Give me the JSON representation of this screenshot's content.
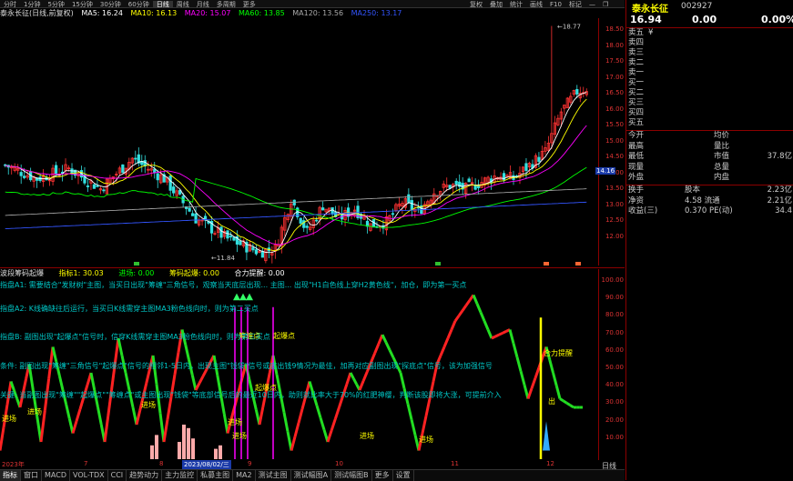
{
  "toolbar": {
    "items": [
      "分时",
      "1分钟",
      "5分钟",
      "15分钟",
      "30分钟",
      "60分钟",
      "日线",
      "周线",
      "月线",
      "多周期",
      "更多"
    ],
    "right_items": [
      "复权",
      "叠加",
      "统计",
      "画线",
      "F10",
      "标记"
    ],
    "right_icons": [
      "minus-icon",
      "restore-icon",
      "close-icon"
    ]
  },
  "main_header": {
    "title": "泰永长征(日线,前复权)",
    "ma5": "MA5: 16.24",
    "ma10": "MA10: 16.13",
    "ma20": "MA20: 15.07",
    "ma60": "MA60: 13.85",
    "ma120": "MA120: 13.56",
    "ma250": "MA250: 13.17",
    "colors": {
      "ma5": "#ffffff",
      "ma10": "#ffff00",
      "ma20": "#ff00ff",
      "ma60": "#00ff00",
      "ma120": "#a0a0a0",
      "ma250": "#3355ff"
    }
  },
  "main_yaxis": [
    "18.50",
    "18.00",
    "17.50",
    "17.00",
    "16.50",
    "16.00",
    "15.50",
    "15.00",
    "14.50",
    "14.00",
    "13.50",
    "13.00",
    "12.50",
    "12.00"
  ],
  "main_annotations": {
    "high": "18.77",
    "low": "11.84",
    "last_price": "14.16"
  },
  "sub_header": {
    "name": "波段筹码起爆",
    "g1": "指标1: 30.03",
    "g2": "进场: 0.00",
    "g3": "筹码起爆: 0.00",
    "g4": "合力提醒: 0.00"
  },
  "sub_yaxis": [
    "100.00",
    "90.00",
    "80.00",
    "70.00",
    "60.00",
    "50.00",
    "40.00",
    "30.00",
    "20.00",
    "10.00"
  ],
  "sub_texts": [
    "指盘A1: 需要结合\"发财树\"主图，当买日出现\"筹缠\"三角信号，观察当天底层出现... 主图... 出现\"H1白色线上穿H2黄色线\"，加仓，即为第一买点",
    "指盘A2: K线确缺往后运行，当买日K线需穿主图MA3粉色线向时，则为第二买点",
    "指盘B: 副图出现\"起爆点\"信号时，信穿K线需穿主图MA3粉色线向时，则为第三买点",
    "条件: 副图出现\"筹缠\"三角信号\"起爆点\"信号的相邻1-5日内，出现主图\"钱袋\"信号或底出钱9情况为最佳，加再对应副图出现\"探底点\"信号，该为加强信号",
    "关键: 当副图出现\"筹缠\"\"起爆点\"\"筹缠点\"或主图出现\"钱袋\"等底部信号后的最近10日内，助则就比率大于70%的红肥神缨，判断该股即将大涨，可提前介入"
  ],
  "sub_markers": {
    "entry": "进场",
    "explode": "起爆点",
    "chip": "筹缠点",
    "stop": "止盈",
    "out": "出",
    "pressure": "合力提醒"
  },
  "date_axis": [
    "2023年",
    "7",
    "8",
    "2023/08/02/三",
    "9",
    "10",
    "11",
    "12"
  ],
  "tabs": [
    "指标",
    "窗口",
    "MACD",
    "VOL-TDX",
    "CCI",
    "趋势动力",
    "主力监控",
    "私募主图",
    "MA2",
    "测试主图",
    "测试幅图A",
    "测试幅图B",
    "更多",
    "设置"
  ],
  "right_panel": {
    "stock_name": "泰永长征",
    "stock_code": "002927",
    "price": "16.94",
    "change": "0.00",
    "change_pct": "0.00%",
    "order_book": [
      {
        "label": "卖五",
        "price": "¥",
        "vol": ""
      },
      {
        "label": "卖四",
        "price": "",
        "vol": ""
      },
      {
        "label": "卖三",
        "price": "",
        "vol": ""
      },
      {
        "label": "卖二",
        "price": "",
        "vol": ""
      },
      {
        "label": "卖一",
        "price": "",
        "vol": ""
      },
      {
        "label": "买一",
        "price": "",
        "vol": ""
      },
      {
        "label": "买二",
        "price": "",
        "vol": ""
      },
      {
        "label": "买三",
        "price": "",
        "vol": ""
      },
      {
        "label": "买四",
        "price": "",
        "vol": ""
      },
      {
        "label": "买五",
        "price": "",
        "vol": ""
      }
    ],
    "stats1": [
      {
        "l": "今开",
        "m": "均价",
        "v": ""
      },
      {
        "l": "最高",
        "m": "量比",
        "v": ""
      },
      {
        "l": "最低",
        "m": "市值",
        "v": "37.8亿"
      },
      {
        "l": "现量",
        "m": "总量",
        "v": ""
      },
      {
        "l": "外盘",
        "m": "内盘",
        "v": ""
      }
    ],
    "stats2": [
      {
        "l": "换手",
        "m": "股本",
        "v": "2.23亿"
      },
      {
        "l": "净资",
        "m": "4.58  流通",
        "v": "2.21亿"
      },
      {
        "l": "收益(三)",
        "m": "0.370  PE(动)",
        "v": "34.4"
      }
    ],
    "side_tabs": [
      "日线",
      "周线",
      "月线"
    ]
  }
}
